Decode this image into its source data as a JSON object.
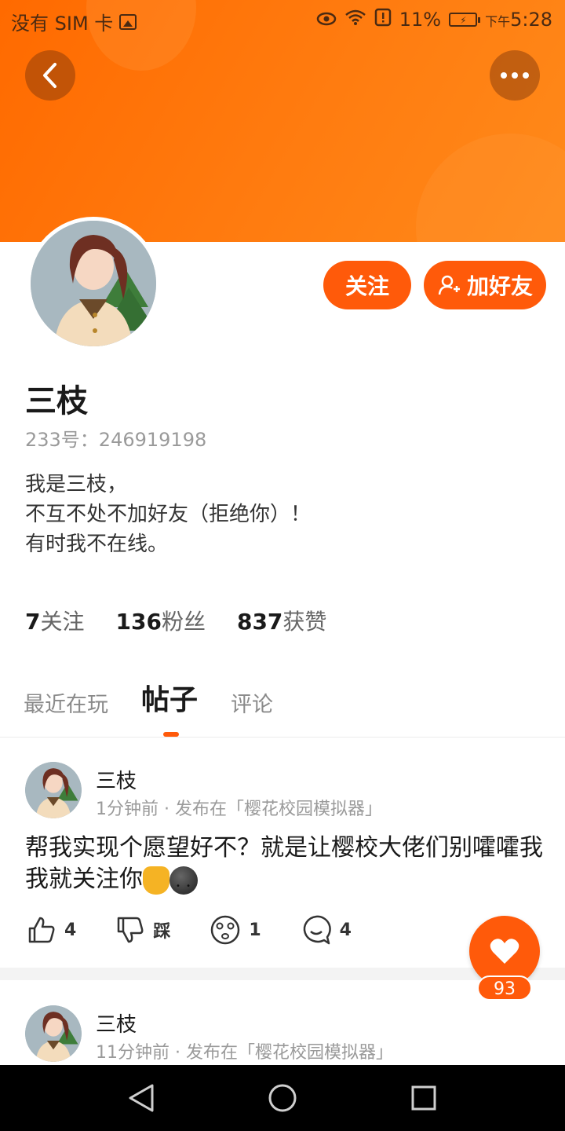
{
  "status_bar": {
    "carrier": "没有 SIM 卡",
    "battery": "11%",
    "time_prefix": "下午",
    "time": "5:28",
    "icons": [
      "gallery-icon",
      "eye-icon",
      "wifi-icon",
      "alert-icon",
      "battery-charging-icon"
    ]
  },
  "header": {
    "back_icon": "chevron-left-icon",
    "more_icon": "more-dots-icon"
  },
  "profile": {
    "name": "三枝",
    "id_label": "233号：246919198",
    "bio_lines": [
      "我是三枝，",
      "不互不处不加好友（拒绝你）！",
      "有时我不在线。"
    ],
    "follow_label": "关注",
    "add_friend_label": "加好友"
  },
  "stats": {
    "following_count": "7",
    "following_label": "关注",
    "fans_count": "136",
    "fans_label": "粉丝",
    "likes_count": "837",
    "likes_label": "获赞"
  },
  "tabs": [
    {
      "label": "最近在玩",
      "active": false
    },
    {
      "label": "帖子",
      "active": true
    },
    {
      "label": "评论",
      "active": false
    }
  ],
  "posts": [
    {
      "author": "三枝",
      "meta": "1分钟前 · 发布在「樱花校园模拟器」",
      "text": "帮我实现个愿望好不？就是让樱校大佬们别嚯嚯我我就关注你",
      "actions": {
        "like": "4",
        "dislike_label": "踩",
        "reaction": "1",
        "comment": "4"
      }
    },
    {
      "author": "三枝",
      "meta": "11分钟前 · 发布在「樱花校园模拟器」"
    }
  ],
  "floating_like": {
    "count": "93"
  },
  "colors": {
    "accent": "#ff5a0a",
    "banner": "#ff7a10"
  }
}
